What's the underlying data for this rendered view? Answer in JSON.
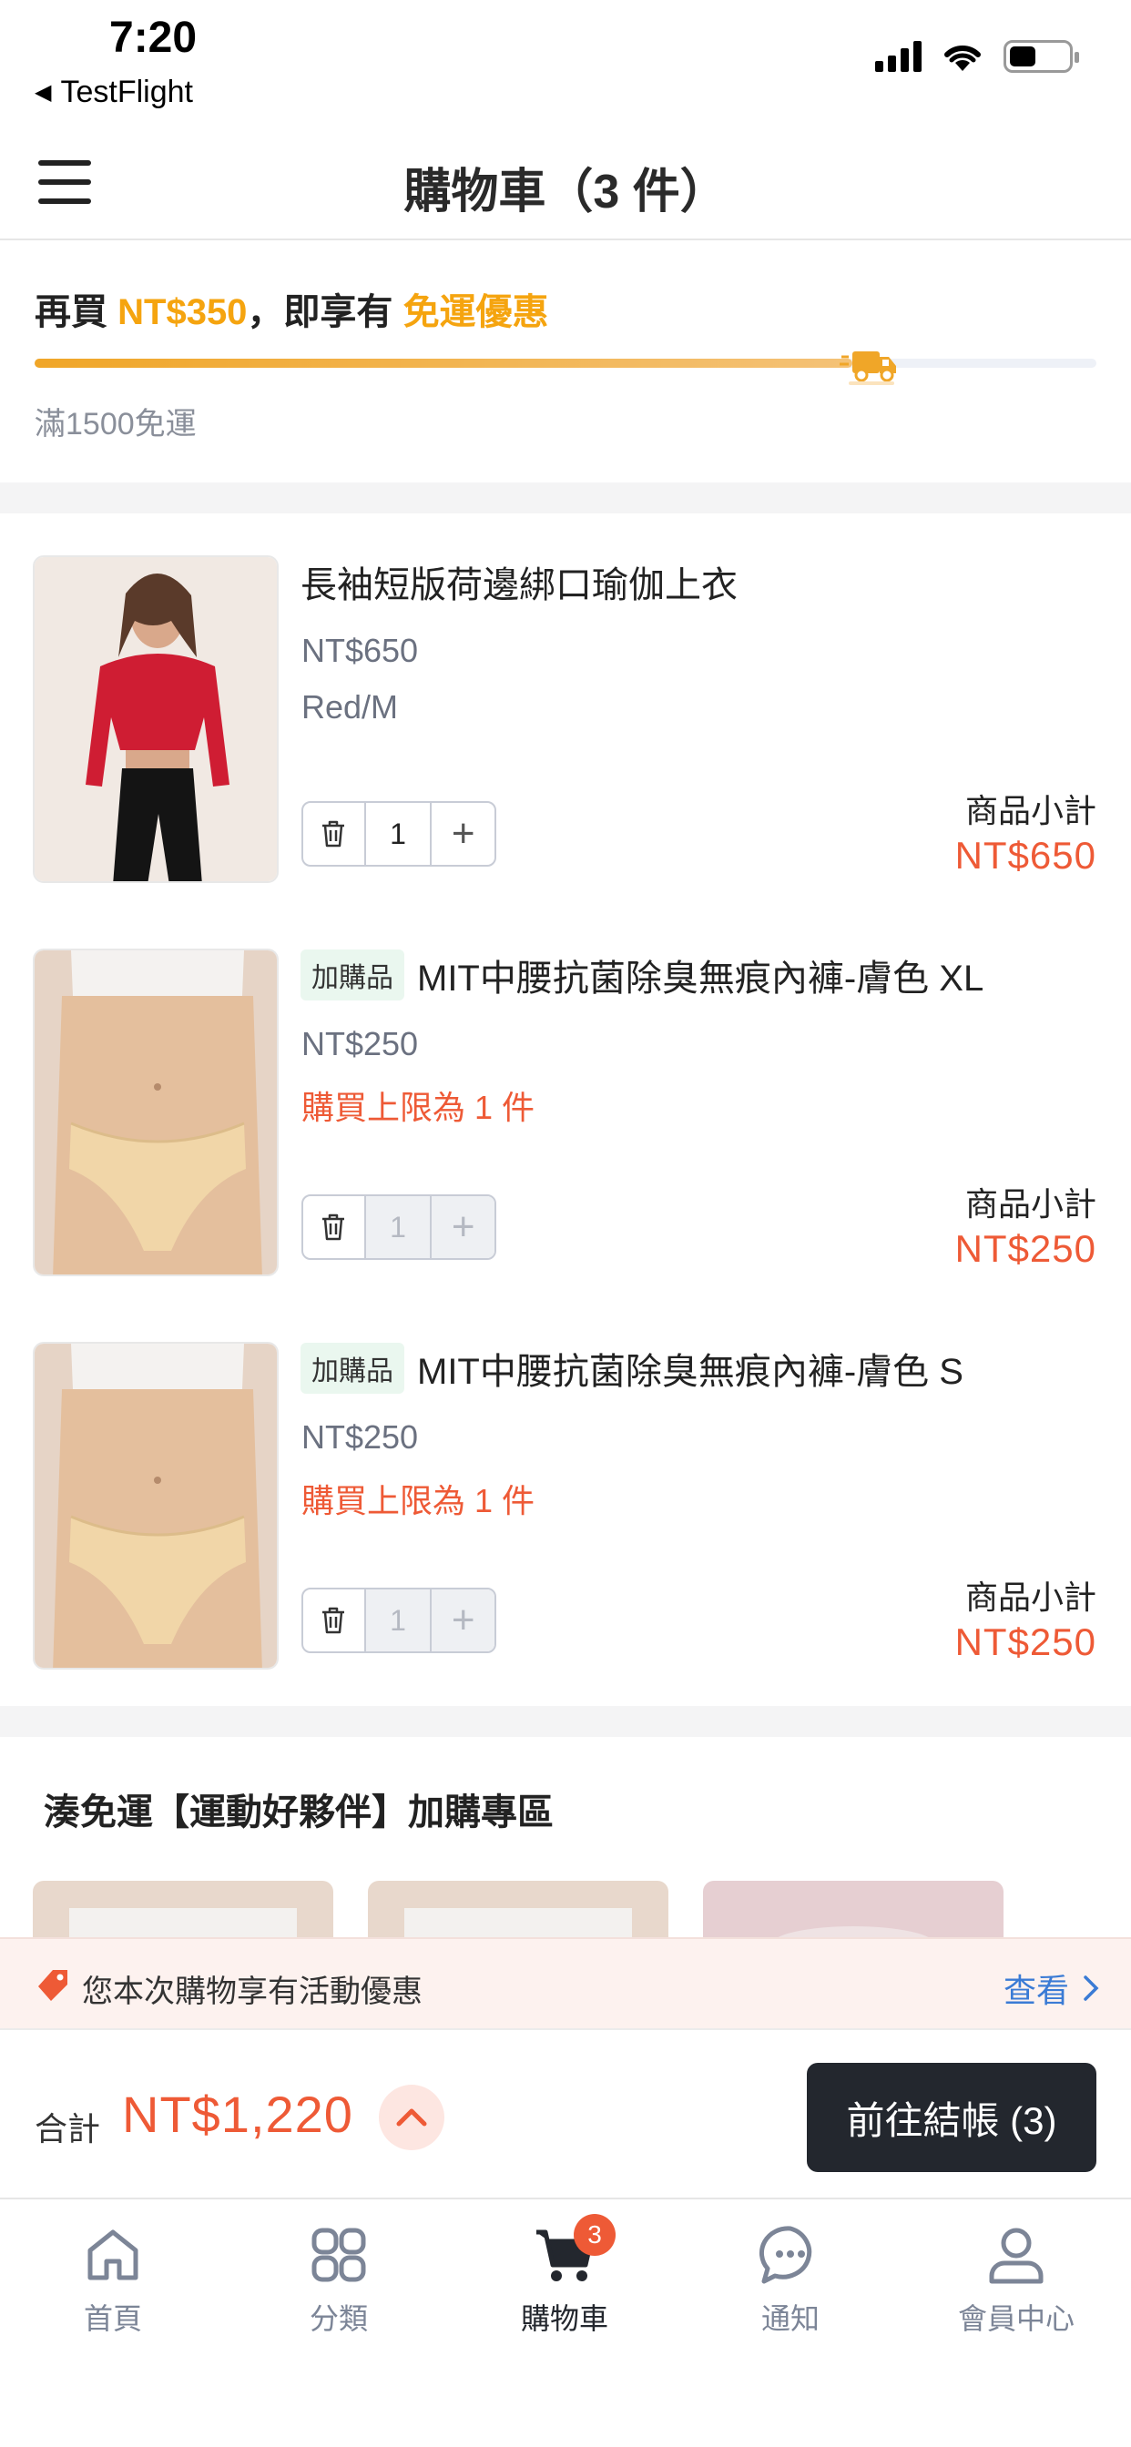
{
  "status_bar": {
    "time": "7:20",
    "back_app": "TestFlight"
  },
  "header": {
    "title": "購物車（3 件）"
  },
  "free_shipping": {
    "prefix": "再買 ",
    "amount": "NT$350",
    "middle": "，即享有 ",
    "benefit": "免運優惠",
    "progress_fraction": 0.77,
    "note": "滿1500免運"
  },
  "items": [
    {
      "tag": "",
      "title": "長袖短版荷邊綁口瑜伽上衣",
      "price": "NT$650",
      "variant": "Red/M",
      "limit": "",
      "qty": "1",
      "subtotal_label": "商品小計",
      "subtotal": "NT$650"
    },
    {
      "tag": "加購品",
      "title": "MIT中腰抗菌除臭無痕內褲-膚色 XL",
      "price": "NT$250",
      "variant": "",
      "limit": "購買上限為 1 件",
      "qty": "1",
      "subtotal_label": "商品小計",
      "subtotal": "NT$250"
    },
    {
      "tag": "加購品",
      "title": "MIT中腰抗菌除臭無痕內褲-膚色 S",
      "price": "NT$250",
      "variant": "",
      "limit": "購買上限為 1 件",
      "qty": "1",
      "subtotal_label": "商品小計",
      "subtotal": "NT$250"
    }
  ],
  "addon_section": {
    "title": "湊免運【運動好夥伴】加購專區"
  },
  "promo": {
    "text": "您本次購物享有活動優惠",
    "link": "查看"
  },
  "checkout": {
    "total_label": "合計",
    "total": "NT$1,220",
    "button": "前往結帳 (3)"
  },
  "tabs": [
    {
      "label": "首頁",
      "icon": "home-icon"
    },
    {
      "label": "分類",
      "icon": "category-icon"
    },
    {
      "label": "購物車",
      "icon": "cart-icon",
      "badge": "3",
      "active": true
    },
    {
      "label": "通知",
      "icon": "chat-icon"
    },
    {
      "label": "會員中心",
      "icon": "user-icon"
    }
  ],
  "colors": {
    "accent_orange": "#f5a40f",
    "price_red": "#ee5a36",
    "link_blue": "#3a7bd5",
    "dark_button": "#23272e"
  }
}
